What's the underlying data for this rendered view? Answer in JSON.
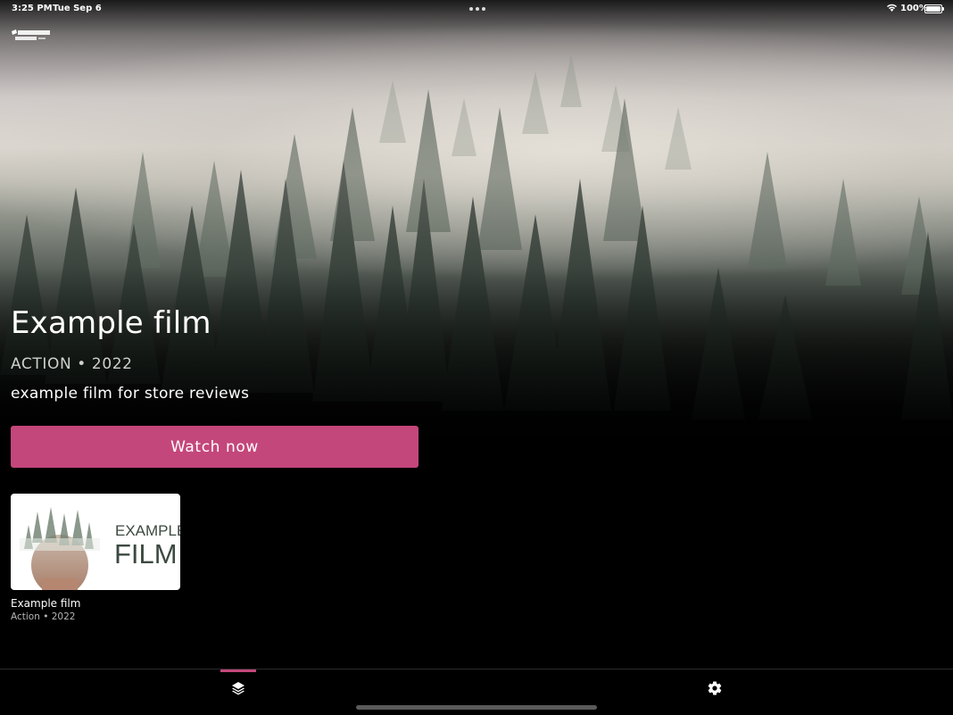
{
  "status_bar": {
    "time": "3:25 PM",
    "date": "Tue Sep 6",
    "battery": "100%",
    "battery_level": 1.0,
    "icons": [
      "multitask-dots-icon",
      "wifi-icon",
      "battery-icon"
    ]
  },
  "logo": {
    "text": "ABERDEEN FILM FESTIVAL 2022",
    "icon": "festival-logo-icon"
  },
  "featured": {
    "title": "Example film",
    "meta": "ACTION • 2022",
    "description": "example film for store reviews",
    "watch_label": "Watch now",
    "background_icon": "misty-forest-image"
  },
  "films": [
    {
      "title": "Example film",
      "meta": "Action • 2022",
      "poster_text_line1": "EXAMPLE",
      "poster_text_line2": "FILM"
    }
  ],
  "tabbar": {
    "tabs": [
      {
        "icon": "layers-icon",
        "active": true
      },
      {
        "icon": "gear-icon",
        "active": false
      }
    ]
  },
  "colors": {
    "accent": "#c4477b",
    "background": "#000000",
    "text": "#ffffff",
    "muted": "#b5b5b5"
  }
}
